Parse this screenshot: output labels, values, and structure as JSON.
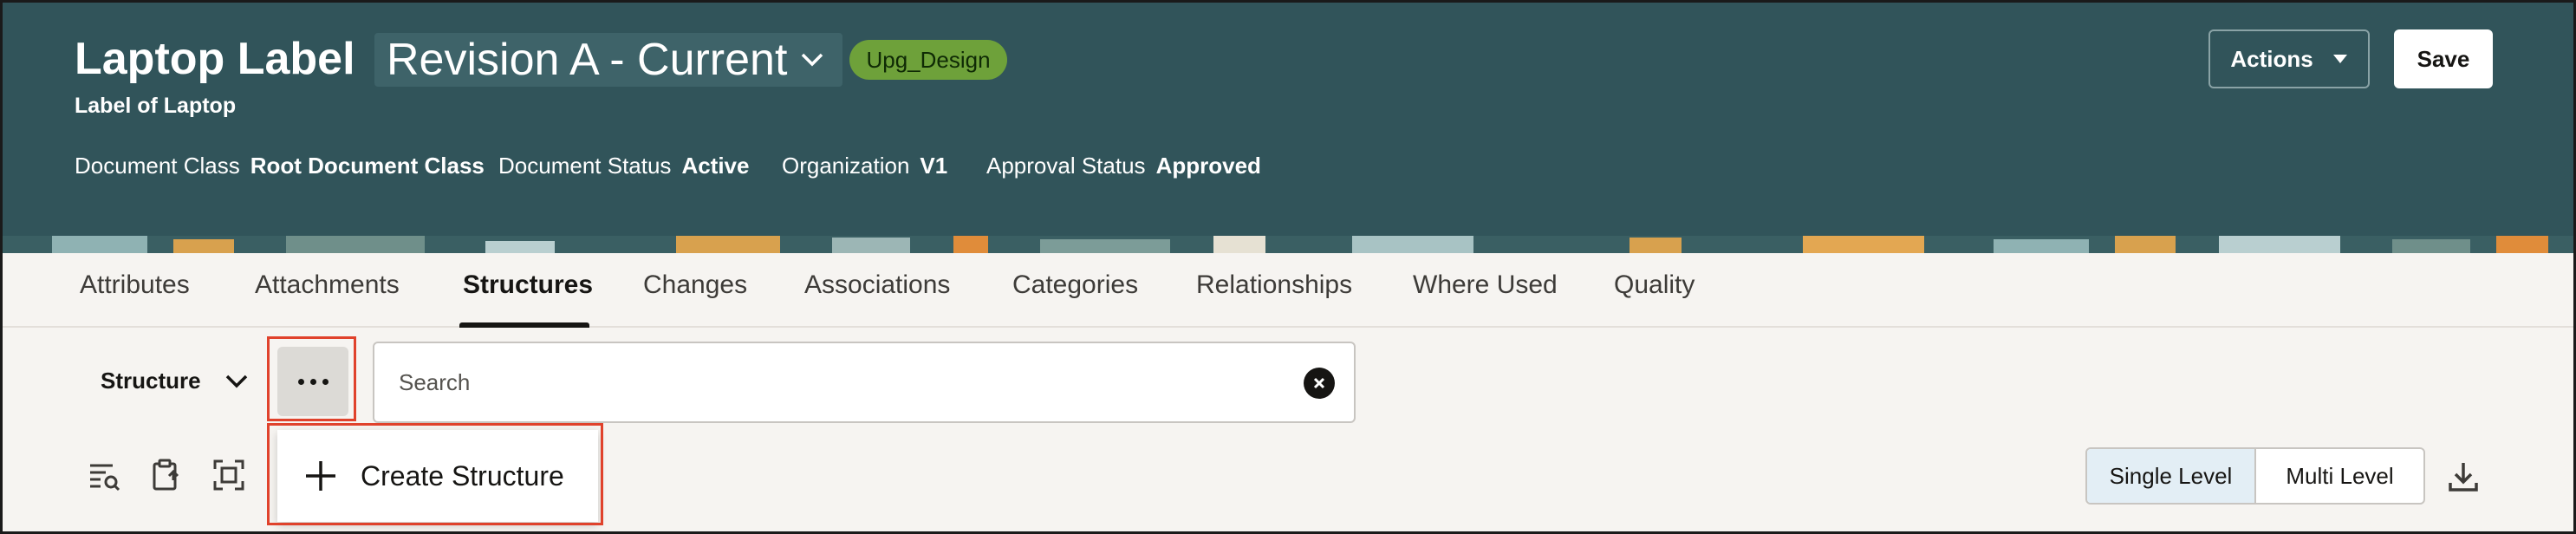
{
  "header": {
    "title": "Laptop Label",
    "revision": "Revision A - Current",
    "badge": "Upg_Design",
    "subtitle": "Label of Laptop",
    "meta": [
      {
        "label": "Document Class",
        "value": "Root Document Class"
      },
      {
        "label": "Document Status",
        "value": "Active"
      },
      {
        "label": "Organization",
        "value": "V1"
      },
      {
        "label": "Approval Status",
        "value": "Approved"
      }
    ],
    "actions_label": "Actions",
    "save_label": "Save"
  },
  "tabs": [
    {
      "label": "Attributes"
    },
    {
      "label": "Attachments"
    },
    {
      "label": "Structures",
      "active": true
    },
    {
      "label": "Changes"
    },
    {
      "label": "Associations"
    },
    {
      "label": "Categories"
    },
    {
      "label": "Relationships"
    },
    {
      "label": "Where Used"
    },
    {
      "label": "Quality"
    }
  ],
  "structure": {
    "label": "Structure",
    "search_placeholder": "Search"
  },
  "menu": {
    "create_label": "Create Structure"
  },
  "toolbar": {
    "icons": [
      "filter-list-icon",
      "paste-icon",
      "fit-view-icon"
    ],
    "single_level": "Single Level",
    "multi_level": "Multi Level",
    "download_icon": "download-icon"
  },
  "colors": {
    "header_bg": "#31545a",
    "badge_bg": "#6ea13a",
    "highlight": "#e0422c",
    "segment_active": "#e3eef5"
  }
}
